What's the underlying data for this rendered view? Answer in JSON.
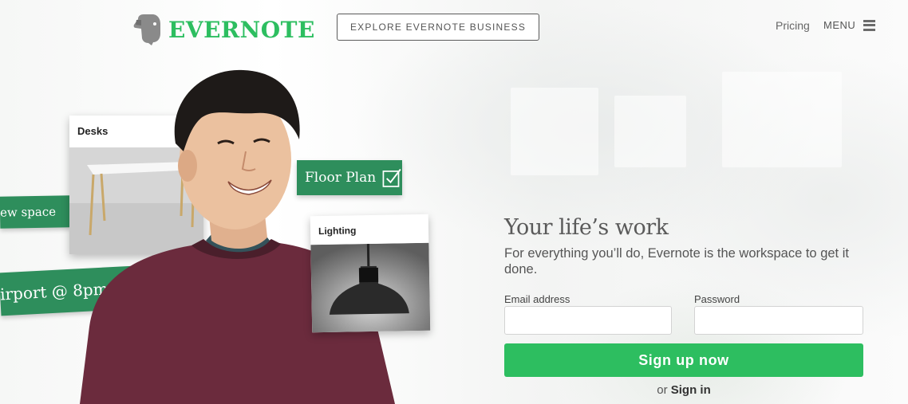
{
  "header": {
    "logo_text": "EVERNOTE",
    "explore_button": "EXPLORE EVERNOTE BUSINESS",
    "pricing_link": "Pricing",
    "menu_label": "MENU"
  },
  "illustration": {
    "desks_card": "Desks",
    "lighting_card": "Lighting",
    "floor_plan_tag": "Floor Plan",
    "new_space_tag": "ew space",
    "airport_tag": "irport @ 8pm"
  },
  "signup": {
    "headline": "Your life’s work",
    "subhead": "For everything you’ll do, Evernote is the workspace to get it done.",
    "email_label": "Email address",
    "password_label": "Password",
    "email_value": "",
    "password_value": "",
    "button_label": "Sign up now",
    "signin_prefix": "or",
    "signin_link": "Sign in"
  },
  "colors": {
    "brand_green": "#2dbe60",
    "tag_green": "#2e8e5c"
  }
}
